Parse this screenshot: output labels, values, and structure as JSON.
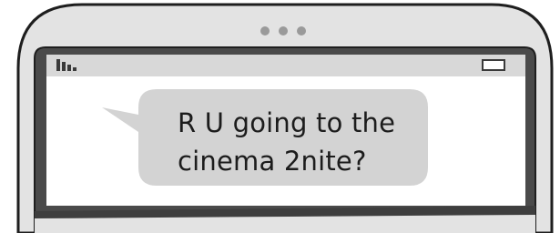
{
  "message": {
    "lines": [
      "R U going to the",
      "cinema 2nite?"
    ],
    "sender": "incoming"
  },
  "status_bar": {
    "signal_icon": "signal-bars-icon",
    "battery_icon": "battery-icon"
  },
  "colors": {
    "phone_body": "#e3e3e3",
    "phone_outline": "#1e1e1e",
    "bezel": "#4a4a4a",
    "screen": "#ffffff",
    "status_bar": "#d8d8d8",
    "bubble": "#d3d3d3",
    "speaker_dots": "#9a9a9a",
    "text": "#1c1c1c"
  }
}
